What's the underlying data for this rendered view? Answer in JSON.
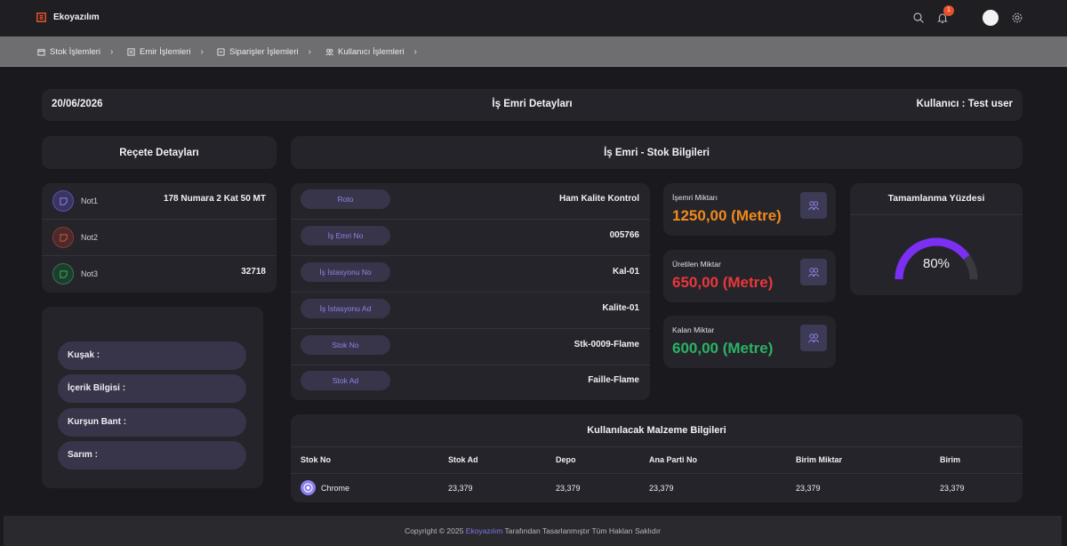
{
  "app": {
    "brand": "Ekoyazılım",
    "notification_count": "1"
  },
  "nav": {
    "items": [
      {
        "label": "Stok İşlemleri"
      },
      {
        "label": "Emir İşlemleri"
      },
      {
        "label": "Siparişler İşlemleri"
      },
      {
        "label": "Kullanıcı İşlemleri"
      }
    ]
  },
  "header": {
    "date": "20/06/2026",
    "title": "İş Emri Detayları",
    "user": "Kullanıcı : Test user"
  },
  "recipe": {
    "title": "Reçete Detayları",
    "notes": [
      {
        "name": "Not1",
        "value": "178 Numara 2 Kat 50 MT",
        "color": "#7b6ff0"
      },
      {
        "name": "Not2",
        "value": "",
        "color": "#e0503c"
      },
      {
        "name": "Not3",
        "value": "32718",
        "color": "#2bb365"
      }
    ],
    "props": [
      "Kuşak :",
      "İçerik Bilgisi :",
      "Kurşun Bant :",
      "Sarım :"
    ]
  },
  "stock_info": {
    "title": "İş Emri - Stok Bilgileri",
    "rows": [
      {
        "label": "Roto",
        "value": "Ham Kalite Kontrol"
      },
      {
        "label": "İş Emri No",
        "value": "005766"
      },
      {
        "label": "İş İstasyonu No",
        "value": "Kal-01"
      },
      {
        "label": "İş İstasyonu Ad",
        "value": "Kalite-01"
      },
      {
        "label": "Stok No",
        "value": "Stk-0009-Flame"
      },
      {
        "label": "Stok Ad",
        "value": "Faille-Flame"
      }
    ]
  },
  "stats": [
    {
      "label": "İşemri Miktarı",
      "value": "1250,00 (Metre)",
      "color": "#f08a1c"
    },
    {
      "label": "Üretilen Miktar",
      "value": "650,00 (Metre)",
      "color": "#e6383c"
    },
    {
      "label": "Kalan Miktar",
      "value": "600,00 (Metre)",
      "color": "#2bb365"
    }
  ],
  "completion": {
    "title": "Tamamlanma Yüzdesi",
    "value_text": "80%",
    "percent": 80
  },
  "materials": {
    "title": "Kullanılacak Malzeme Bilgileri",
    "columns": [
      "Stok No",
      "Stok Ad",
      "Depo",
      "Ana Parti No",
      "Birim Miktar",
      "Birim"
    ],
    "rows": [
      [
        "Chrome",
        "23,379",
        "23,379",
        "23,379",
        "23,379",
        "23,379"
      ]
    ]
  },
  "footer": {
    "prefix": "Copyright © 2025",
    "brand": "Ekoyazılım",
    "suffix": "Tarafından Tasarlanmıştır Tüm Hakları Saklıdır"
  }
}
